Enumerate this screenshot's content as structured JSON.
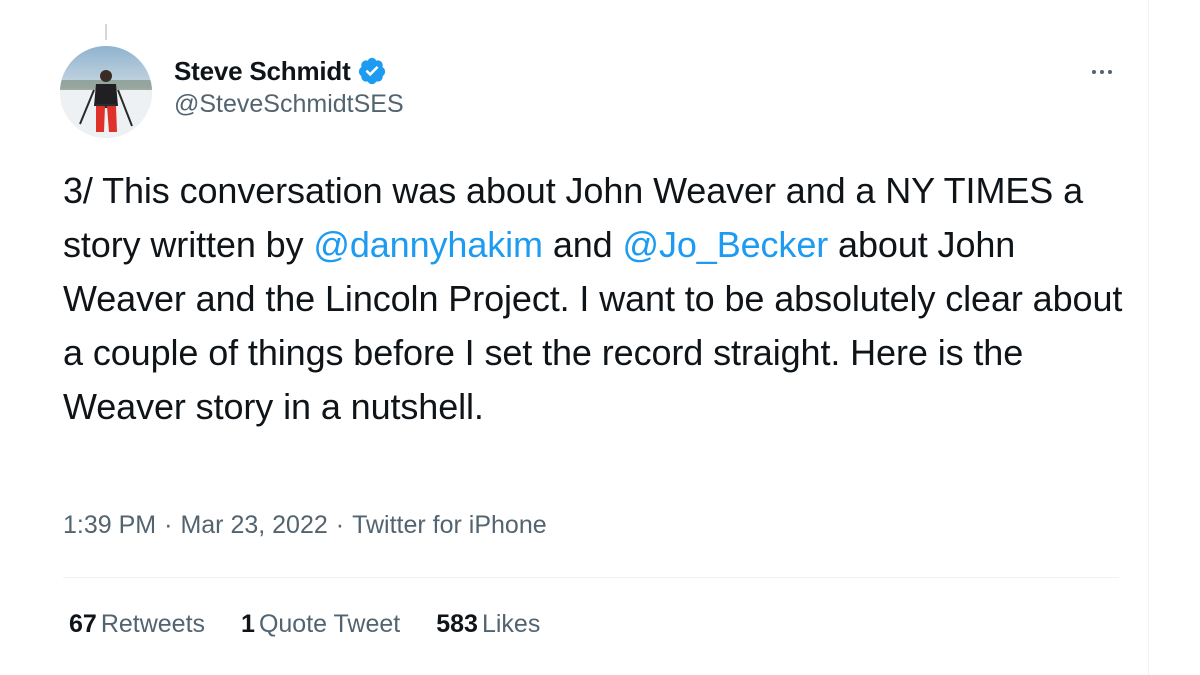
{
  "author": {
    "display_name": "Steve Schmidt",
    "handle": "@SteveSchmidtSES",
    "verified": true
  },
  "tweet": {
    "segments": [
      {
        "text": "3/ This conversation was about John Weaver and a NY TIMES a story written by ",
        "type": "text"
      },
      {
        "text": "@dannyhakim",
        "type": "mention"
      },
      {
        "text": " and ",
        "type": "text"
      },
      {
        "text": "@Jo_Becker",
        "type": "mention"
      },
      {
        "text": " about John Weaver and the Lincoln Project. I want to be absolutely clear about a couple of things before I set the record straight. Here is the Weaver story in a nutshell.",
        "type": "text"
      }
    ]
  },
  "meta": {
    "time": "1:39 PM",
    "date": "Mar 23, 2022",
    "source": "Twitter for iPhone",
    "separator": "·"
  },
  "stats": {
    "retweets_count": "67",
    "retweets_label": "Retweets",
    "quotes_count": "1",
    "quotes_label": "Quote Tweet",
    "likes_count": "583",
    "likes_label": "Likes"
  },
  "colors": {
    "link": "#1d9bf0",
    "secondary_text": "#536471",
    "primary_text": "#0f1419",
    "verified_badge": "#1d9bf0"
  },
  "icons": {
    "verified": "verified-badge-icon",
    "more": "more-options-icon"
  }
}
